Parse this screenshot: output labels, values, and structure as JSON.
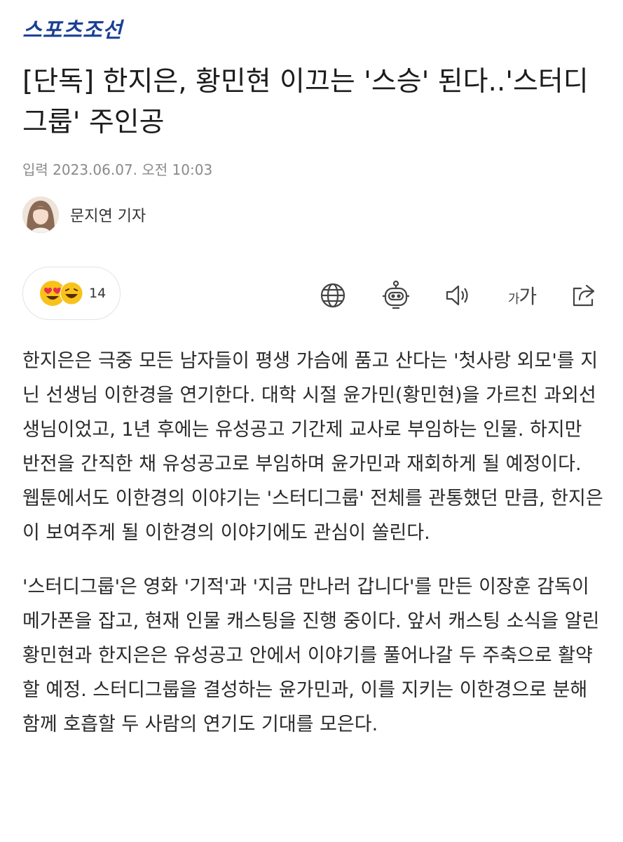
{
  "header": {
    "logo_text": "스포츠조선"
  },
  "article": {
    "title": "[단독] 한지은, 황민현 이끄는 '스승' 된다..'스터디그룹' 주인공",
    "published": "입력 2023.06.07. 오전 10:03",
    "author": "문지연 기자",
    "paragraphs": [
      "한지은은 극중 모든 남자들이 평생 가슴에 품고 산다는 '첫사랑 외모'를 지닌 선생님 이한경을 연기한다. 대학 시절 윤가민(황민현)을 가르친 과외선생님이었고, 1년 후에는 유성공고 기간제 교사로 부임하는 인물. 하지만 반전을 간직한 채 유성공고로 부임하며 윤가민과 재회하게 될 예정이다. 웹툰에서도 이한경의 이야기는 '스터디그룹' 전체를 관통했던 만큼, 한지은이 보여주게 될 이한경의 이야기에도 관심이 쏠린다.",
      "'스터디그룹'은 영화 '기적'과 '지금 만나러 갑니다'를 만든 이장훈 감독이 메가폰을 잡고, 현재 인물 캐스팅을 진행 중이다. 앞서 캐스팅 소식을 알린 황민현과 한지은은 유성공고 안에서 이야기를 풀어나갈 두 주축으로 활약할 예정. 스터디그룹을 결성하는 윤가민과, 이를 지키는 이한경으로 분해 함께 호흡할 두 사람의 연기도 기대를 모은다."
    ]
  },
  "reactions": {
    "count": "14",
    "icons": [
      "heart-eyes-emoji-icon",
      "grinning-emoji-icon"
    ]
  },
  "toolbar": {
    "icons": [
      "globe-icon",
      "robot-icon",
      "speaker-icon",
      "font-size-icon",
      "share-icon"
    ],
    "font_small": "가",
    "font_large": "가"
  },
  "colors": {
    "logo": "#1a3f95",
    "emoji": "#f7c31a",
    "heart": "#e8304a",
    "meta": "#8a8a8a"
  }
}
